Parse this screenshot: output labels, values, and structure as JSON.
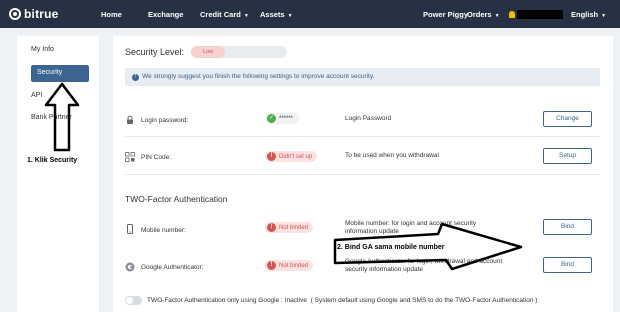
{
  "topbar": {
    "logo": "bitrue",
    "nav": [
      {
        "label": "Home",
        "dropdown": false
      },
      {
        "label": "Exchange",
        "dropdown": false
      },
      {
        "label": "Credit Card",
        "dropdown": true
      },
      {
        "label": "Assets",
        "dropdown": true
      }
    ],
    "right": {
      "username": "Power Piggy",
      "orders": "Orders",
      "language": "English"
    }
  },
  "sidebar": {
    "items": [
      {
        "label": "My Info",
        "active": false
      },
      {
        "label": "Security",
        "active": true
      },
      {
        "label": "API",
        "active": false
      },
      {
        "label": "Bank Partner",
        "active": false
      }
    ]
  },
  "security": {
    "level_label": "Security Level:",
    "level_value": "Low",
    "notice": "We strongly suggest you finish the following settings to improve account security.",
    "rows": [
      {
        "label": "Login password:",
        "status": "******",
        "status_ok": true,
        "description": "Login Password",
        "button": "Change"
      },
      {
        "label": "PIN Code:",
        "status": "Didn't set up",
        "status_ok": false,
        "description": "To be used when you withdrawal",
        "button": "Setup"
      }
    ]
  },
  "two_factor": {
    "title": "TWO-Factor Authentication",
    "rows": [
      {
        "label": "Mobile number:",
        "status": "Not binded",
        "description": "Mobile number: for login and account security information update",
        "button": "Bind"
      },
      {
        "label": "Google Authenticator:",
        "status": "Not binded",
        "description": "Google Authenticator for login, withdrawal and account security information update",
        "button": "Bind"
      }
    ],
    "toggle_text": "TWO-Factor Authentication only using Google : Inactive  ( System default using Google and SMS to do the TWO-Factor Authentication )"
  },
  "annotations": {
    "step1": "1. Klik Security",
    "step2": "2. Bind GA sama mobile number"
  },
  "colors": {
    "topbar": "#263244",
    "accent": "#3d6591",
    "danger": "#d9534f",
    "success": "#4caf50"
  }
}
